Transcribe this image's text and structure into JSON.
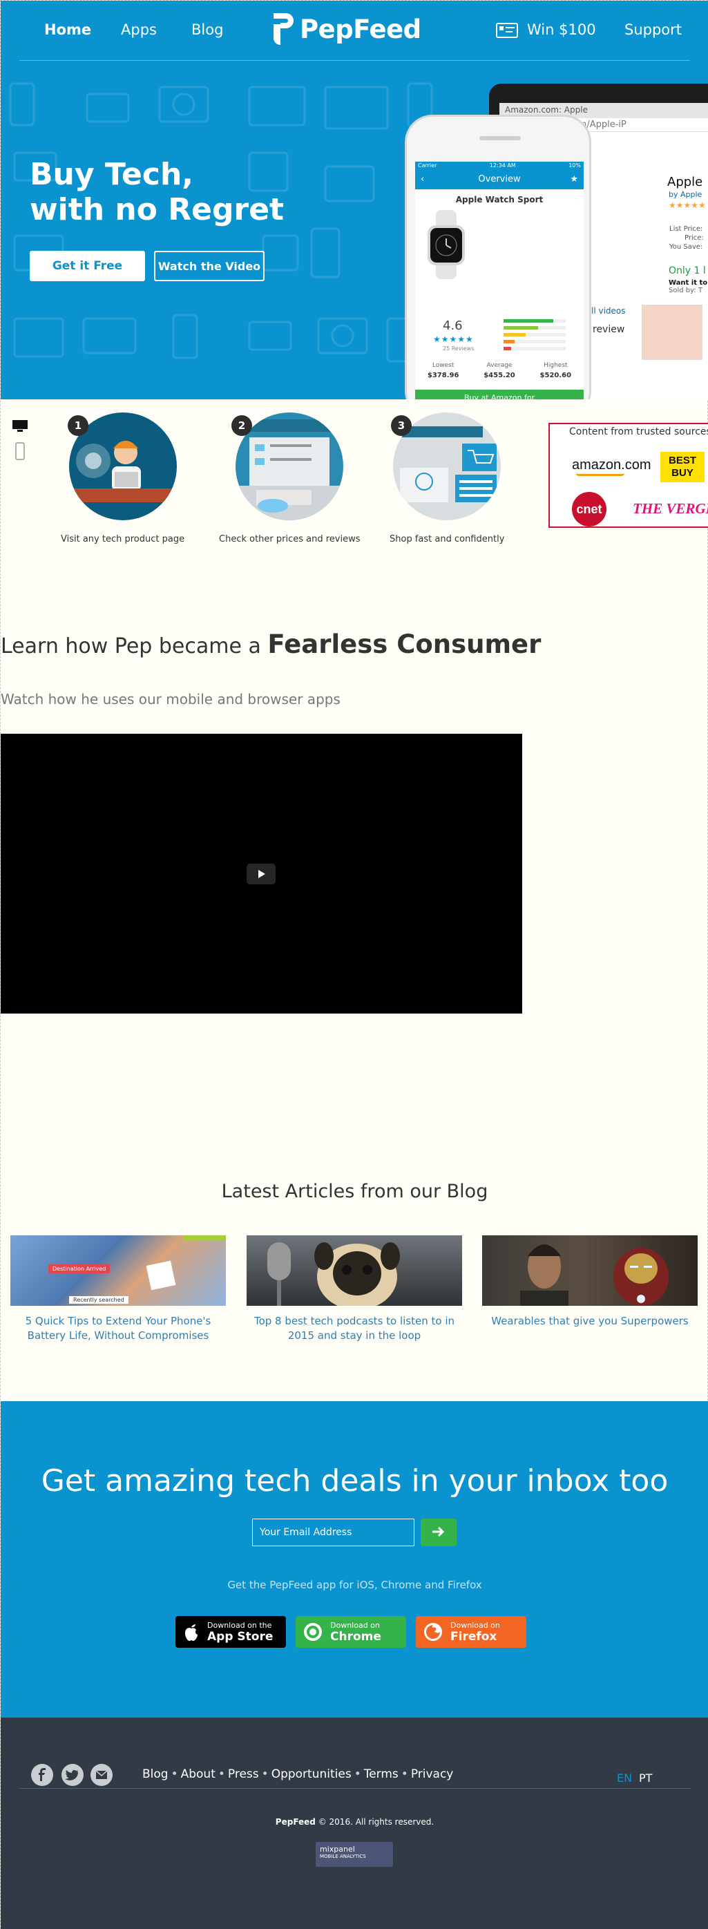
{
  "nav": {
    "home": "Home",
    "apps": "Apps",
    "blog": "Blog",
    "brand": "PepFeed",
    "win": "Win $100",
    "support": "Support"
  },
  "hero": {
    "title_line1": "Buy Tech,",
    "title_line2": "with no Regret",
    "btn_free": "Get it Free",
    "btn_video": "Watch the Video"
  },
  "mockup": {
    "browser_tab": "Amazon.com: Apple",
    "browser_url": "www.amazon.com/Apple-iP",
    "phone_carrier": "Carrier",
    "phone_time": "12:34 AM",
    "phone_battery": "10%",
    "phone_header": "Overview",
    "product": "Apple Watch Sport",
    "rating": "4.6",
    "stars": "★★★★★",
    "reviews": "25 Reviews",
    "prices": [
      {
        "label": "Lowest",
        "value": "$378.96"
      },
      {
        "label": "Average",
        "value": "$455.20"
      },
      {
        "label": "Highest",
        "value": "$520.60"
      }
    ],
    "buy": "Buy at Amazon for",
    "amz_title": "Apple",
    "amz_by": "by Apple",
    "amz_stars": "★★★★★",
    "amz_list": [
      "List Price:",
      "Price:",
      "You Save:"
    ],
    "amz_only": "Only 1 l",
    "amz_want": "Want it to",
    "amz_sold": "Sold by: T",
    "amz_videos": "ll videos",
    "amz_review": "review"
  },
  "steps": [
    {
      "num": "1",
      "label": "Visit any tech product page"
    },
    {
      "num": "2",
      "label": "Check other prices and reviews"
    },
    {
      "num": "3",
      "label": "Shop fast and confidently"
    }
  ],
  "trusted": {
    "title": "Content from trusted sources",
    "logos": [
      "amazon.com",
      "BEST BUY",
      "cnet",
      "THE VERGE"
    ]
  },
  "learn": {
    "title_plain": "Learn how Pep became a ",
    "title_bold": "Fearless Consumer",
    "subtitle": "Watch how he uses our mobile and browser apps"
  },
  "blog": {
    "title": "Latest Articles from our Blog",
    "articles": [
      {
        "caption": "5 Quick Tips to Extend Your Phone's Battery Life, Without Compromises",
        "img_text1": "Destination Arrived",
        "img_text2": "Recently searched"
      },
      {
        "caption": "Top 8 best tech podcasts to listen to in 2015 and stay in the loop"
      },
      {
        "caption": "Wearables that give you Superpowers"
      }
    ]
  },
  "deals": {
    "title": "Get amazing tech deals in your inbox too",
    "email_placeholder": "Your Email Address",
    "app_note": "Get the PepFeed app for iOS, Chrome and Firefox",
    "stores": [
      {
        "small": "Download on the",
        "large": "App Store",
        "color": "#000000"
      },
      {
        "small": "Download on",
        "large": "Chrome",
        "color": "#35b34a"
      },
      {
        "small": "Download on",
        "large": "Firefox",
        "color": "#f26522"
      }
    ]
  },
  "footer": {
    "links": [
      "Blog",
      "About",
      "Press",
      "Opportunities",
      "Terms",
      "Privacy"
    ],
    "lang_en": "EN",
    "lang_pt": "PT",
    "copyright_brand": "PepFeed",
    "copyright_rest": " © 2016. All rights reserved.",
    "mixpanel_name": "mixpanel",
    "mixpanel_sub": "MOBILE ANALYTICS"
  },
  "colors": {
    "brand_blue": "#0b93d0",
    "green": "#35b34a",
    "footer_bg": "#323a45",
    "link": "#2d7fb5"
  }
}
